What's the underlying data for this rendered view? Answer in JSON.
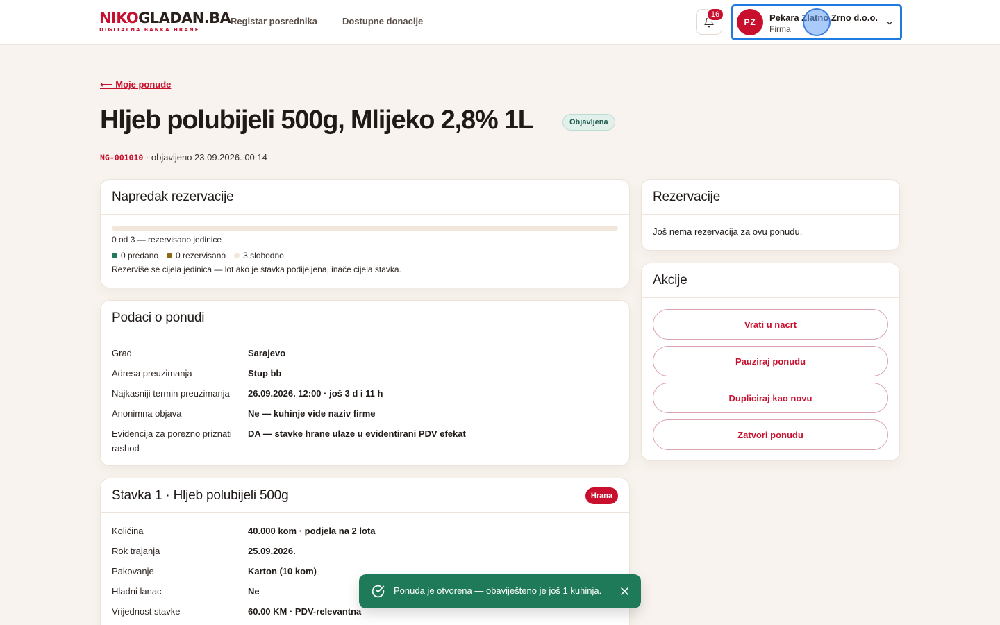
{
  "brand": {
    "logo_part1": "NIKO",
    "logo_part2": "GLADAN.BA",
    "tagline": "DIGITALNA BANKA HRANE"
  },
  "nav": {
    "items": [
      "Registar posrednika",
      "Dostupne donacije"
    ]
  },
  "notifications": {
    "count": "16"
  },
  "account": {
    "initials": "PZ",
    "name": "Pekara Zlatno Zrno d.o.o.",
    "role": "Firma"
  },
  "page": {
    "back_label": "⟵ Moje ponude",
    "title": "Hljeb polubijeli 500g, Mlijeko 2,8% 1L",
    "status": "Objavljena",
    "code": "NG-001010",
    "published": "· objavljeno 23.09.2026. 00:14"
  },
  "progress": {
    "heading": "Napredak rezervacije",
    "fraction": 0,
    "summary": "0 od 3 — rezervisano jedinice",
    "legend": [
      {
        "label": "0 predano",
        "color": "#1f7a5a"
      },
      {
        "label": "0 rezervisano",
        "color": "#8a6a12"
      },
      {
        "label": "3 slobodno",
        "color": "#f2e7db"
      }
    ],
    "note": "Rezerviše se cijela jedinica — lot ako je stavka podijeljena, inače cijela stavka."
  },
  "offer": {
    "heading": "Podaci o ponudi",
    "rows": [
      {
        "k": "Grad",
        "v": "Sarajevo"
      },
      {
        "k": "Adresa preuzimanja",
        "v": "Stup bb"
      },
      {
        "k": "Najkasniji termin preuzimanja",
        "v": "26.09.2026. 12:00 · još 3 d i 11 h"
      },
      {
        "k": "Anonimna objava",
        "v": "Ne — kuhinje vide naziv firme"
      },
      {
        "k": "Evidencija za porezno priznati rashod",
        "v": "DA — stavke hrane ulaze u evidentirani PDV efekat"
      }
    ]
  },
  "item1": {
    "heading": "Stavka 1 · Hljeb polubijeli 500g",
    "tag": "Hrana",
    "rows": [
      {
        "k": "Količina",
        "v": "40.000 kom · podjela na 2 lota"
      },
      {
        "k": "Rok trajanja",
        "v": "25.09.2026."
      },
      {
        "k": "Pakovanje",
        "v": "Karton (10 kom)"
      },
      {
        "k": "Hladni lanac",
        "v": "Ne"
      },
      {
        "k": "Vrijednost stavke",
        "v": "60.00 KM · PDV-relevantna"
      }
    ]
  },
  "reservations": {
    "heading": "Rezervacije",
    "empty": "Još nema rezervacija za ovu ponudu."
  },
  "actions": {
    "heading": "Akcije",
    "buttons": [
      "Vrati u nacrt",
      "Pauziraj ponudu",
      "Dupliciraj kao novu",
      "Zatvori ponudu"
    ]
  },
  "toast": {
    "message": "Ponuda je otvorena — obaviješteno je još 1 kuhinja."
  },
  "icons": {
    "bell": "bell-icon",
    "chevron": "chevron-down-icon",
    "check": "check-circle-icon",
    "close": "close-icon"
  },
  "colors": {
    "brand_red": "#c8102e",
    "success_green": "#1f7a5a",
    "background": "#f8f3ee",
    "focus_blue": "#1e7be0"
  }
}
